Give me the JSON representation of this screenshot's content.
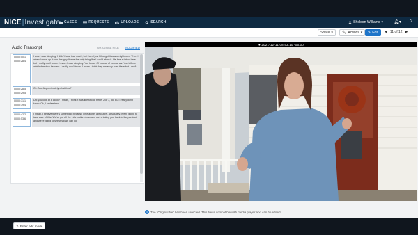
{
  "app": {
    "brand": "NICE",
    "product": "Investigate"
  },
  "nav": [
    {
      "label": "CASES",
      "icon": "folder-icon"
    },
    {
      "label": "REQUESTS",
      "icon": "list-icon"
    },
    {
      "label": "UPLOADS",
      "icon": "cloud-upload-icon"
    },
    {
      "label": "SEARCH",
      "icon": "search-icon"
    }
  ],
  "user": {
    "name": "Sheldon Williams",
    "icon": "user-icon",
    "bell_icon": "bell-icon",
    "help_icon": "question-icon"
  },
  "toolbar": {
    "share_label": "Share",
    "actions_label": "Actions",
    "edit_label": "Edit",
    "pager_label": "11 of 12"
  },
  "transcript": {
    "title": "Audio Transcript",
    "tabs": [
      "ORIGINAL FILE",
      "MODIFIED"
    ],
    "active_tab": "MODIFIED",
    "segments": [
      {
        "start": "00:00:00.1",
        "end": "00:00:28.4",
        "text": "I was I was sleeping. I didn't hear that much, but then I just I thought it was a nightmare. Then I when I woke up it was this guy. It was the only thing like I could show it. He has a tattoo here but I really don't know. I mean I was sleeping. You know. Of course of course car. You tell me which direction he went. I really don't know. I mean I think they runaway over there but I can't."
      },
      {
        "start": "00:00:28.5",
        "end": "00:00:29.5",
        "text": "Ok. And Approximately what time?"
      },
      {
        "start": "00:00:31.1",
        "end": "00:00:39.4",
        "text": "Did you look at a clock? I mean, I think it was like two or three, 2 or 3, ok. But I really don't know.  Ok, I understand."
      },
      {
        "start": "00:00:42.2",
        "end": "00:00:53.6",
        "text": "I mean, I believe there's something because I me alone. absolutely. Absolutely. We're going to take care of this. We've got all the information down and we're taking you back to the precinct and we're going to see what we can do."
      }
    ],
    "edit_mode_label": "Enter edit mode"
  },
  "video": {
    "timestamp": "2021-12-11 08:53:10 -05:00"
  },
  "info_message": "The \"Original file\" has been selected. This file is compatible with media player and can be edited."
}
